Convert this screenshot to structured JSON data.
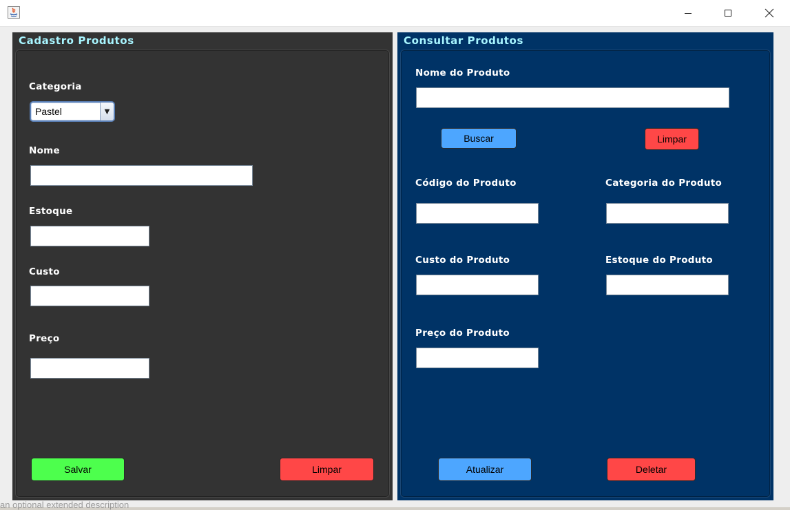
{
  "window": {
    "icon": "java-app-icon",
    "controls": [
      "minimize-icon",
      "maximize-icon",
      "close-icon"
    ]
  },
  "cadastro": {
    "title": "Cadastro Produtos",
    "categoria_label": "Categoria",
    "categoria_value": "Pastel",
    "nome_label": "Nome",
    "nome_value": "",
    "estoque_label": "Estoque",
    "estoque_value": "",
    "custo_label": "Custo",
    "custo_value": "",
    "preco_label": "Preço",
    "preco_value": "",
    "salvar_label": "Salvar",
    "limpar_label": "Limpar"
  },
  "consultar": {
    "title": "Consultar Produtos",
    "nome_label": "Nome do Produto",
    "nome_value": "",
    "buscar_label": "Buscar",
    "limpar_label": "Limpar",
    "codigo_label": "Código do Produto",
    "codigo_value": "",
    "categoria_label": "Categoria do Produto",
    "categoria_value": "",
    "custo_label": "Custo do Produto",
    "custo_value": "",
    "estoque_label": "Estoque do Produto",
    "estoque_value": "",
    "preco_label": "Preço do Produto",
    "preco_value": "",
    "atualizar_label": "Atualizar",
    "deletar_label": "Deletar"
  },
  "background": {
    "overflow_text": "an optional extended description"
  },
  "colors": {
    "left_panel": "#333333",
    "right_panel": "#003366",
    "title_text": "#a8f5ff",
    "green_button": "#4dff4d",
    "red_button": "#ff4747",
    "blue_button": "#4da6ff"
  }
}
